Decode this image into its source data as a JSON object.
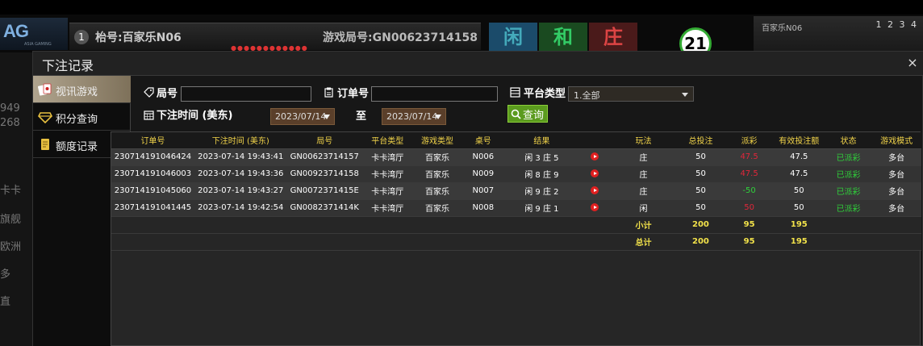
{
  "background": {
    "logo": "AG",
    "logo_sub": "ASIA GAMING",
    "table_no": "1",
    "table_name": "枱号:百家乐N06",
    "game_round": "游戏局号:GN00623714158",
    "bet_player": "闲",
    "bet_tie": "和",
    "bet_banker": "庄",
    "round_count": "21",
    "right_label": "百家乐N06",
    "right_nums": "1 2 3 4",
    "side_labels": [
      "949",
      "268",
      "卡卡",
      "旗舰",
      "欧洲",
      "多",
      "直"
    ]
  },
  "modal": {
    "title": "下注记录",
    "close": "×"
  },
  "nav": [
    {
      "label": "视讯游戏",
      "icon": "cards-icon"
    },
    {
      "label": "积分查询",
      "icon": "diamond-icon"
    },
    {
      "label": "额度记录",
      "icon": "document-icon"
    }
  ],
  "filters": {
    "round_label": "局号",
    "round_value": "",
    "order_label": "订单号",
    "order_value": "",
    "platform_label": "平台类型",
    "platform_value": "1.全部",
    "time_label": "下注时间 (美东)",
    "date_from": "2023/07/14",
    "to_label": "至",
    "date_to": "2023/07/14",
    "search_label": "查询"
  },
  "table": {
    "headers": [
      "订单号",
      "下注时间 (美东)",
      "局号",
      "平台类型",
      "游戏类型",
      "桌号",
      "结果",
      "",
      "玩法",
      "总投注",
      "派彩",
      "有效投注额",
      "状态",
      "游戏模式"
    ],
    "rows": [
      [
        "230714191046424",
        "2023-07-14 19:43:41",
        "GN00623714157",
        "卡卡湾厅",
        "百家乐",
        "N006",
        "闲 3 庄 5",
        "",
        "庄",
        "50",
        "47.5",
        "47.5",
        "已派彩",
        "多台"
      ],
      [
        "230714191046003",
        "2023-07-14 19:43:36",
        "GN00923714158",
        "卡卡湾厅",
        "百家乐",
        "N009",
        "闲 8 庄 9",
        "",
        "庄",
        "50",
        "47.5",
        "47.5",
        "已派彩",
        "多台"
      ],
      [
        "230714191045060",
        "2023-07-14 19:43:27",
        "GN0072371415E",
        "卡卡湾厅",
        "百家乐",
        "N007",
        "闲 9 庄 2",
        "",
        "庄",
        "50",
        "-50",
        "50",
        "已派彩",
        "多台"
      ],
      [
        "230714191041445",
        "2023-07-14 19:42:54",
        "GN0082371414K",
        "卡卡湾厅",
        "百家乐",
        "N008",
        "闲 9 庄 1",
        "",
        "闲",
        "50",
        "50",
        "50",
        "已派彩",
        "多台"
      ]
    ],
    "subtotal": {
      "label": "小计",
      "total_bet": "200",
      "payout": "95",
      "valid_bet": "195"
    },
    "total": {
      "label": "总计",
      "total_bet": "200",
      "payout": "95",
      "valid_bet": "195"
    }
  }
}
